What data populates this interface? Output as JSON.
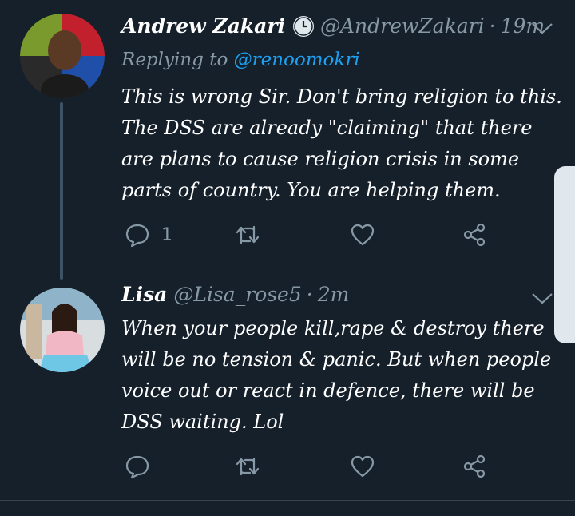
{
  "tweets": [
    {
      "name": "Andrew Zakari",
      "handle": "@AndrewZakari",
      "time": "19m",
      "replying_to_label": "Replying to",
      "replying_to": "@renoomokri",
      "text": "This is wrong Sir. Don't bring religion to this. The DSS are already \"claiming\" that there are plans to cause religion crisis in some parts of country. You are helping them.",
      "reply_count": "1",
      "avatar_colors": [
        "#c3202e",
        "#7a9a2e",
        "#1f4fa8",
        "#2a2a2a"
      ]
    },
    {
      "name": "Lisa",
      "handle": "@Lisa_rose5",
      "time": "2m",
      "text": "When your people kill,rape & destroy there will be no tension & panic. But when people voice out or react in defence, there will be DSS waiting. Lol",
      "reply_count": ""
    }
  ],
  "separator": "·",
  "icons": {
    "clock": "clock-icon",
    "chevron": "chevron-down-icon",
    "reply": "reply-icon",
    "retweet": "retweet-icon",
    "like": "heart-icon",
    "share": "share-icon"
  },
  "colors": {
    "background": "#15202b",
    "secondary_text": "#8899a6",
    "link": "#1da1f2"
  }
}
